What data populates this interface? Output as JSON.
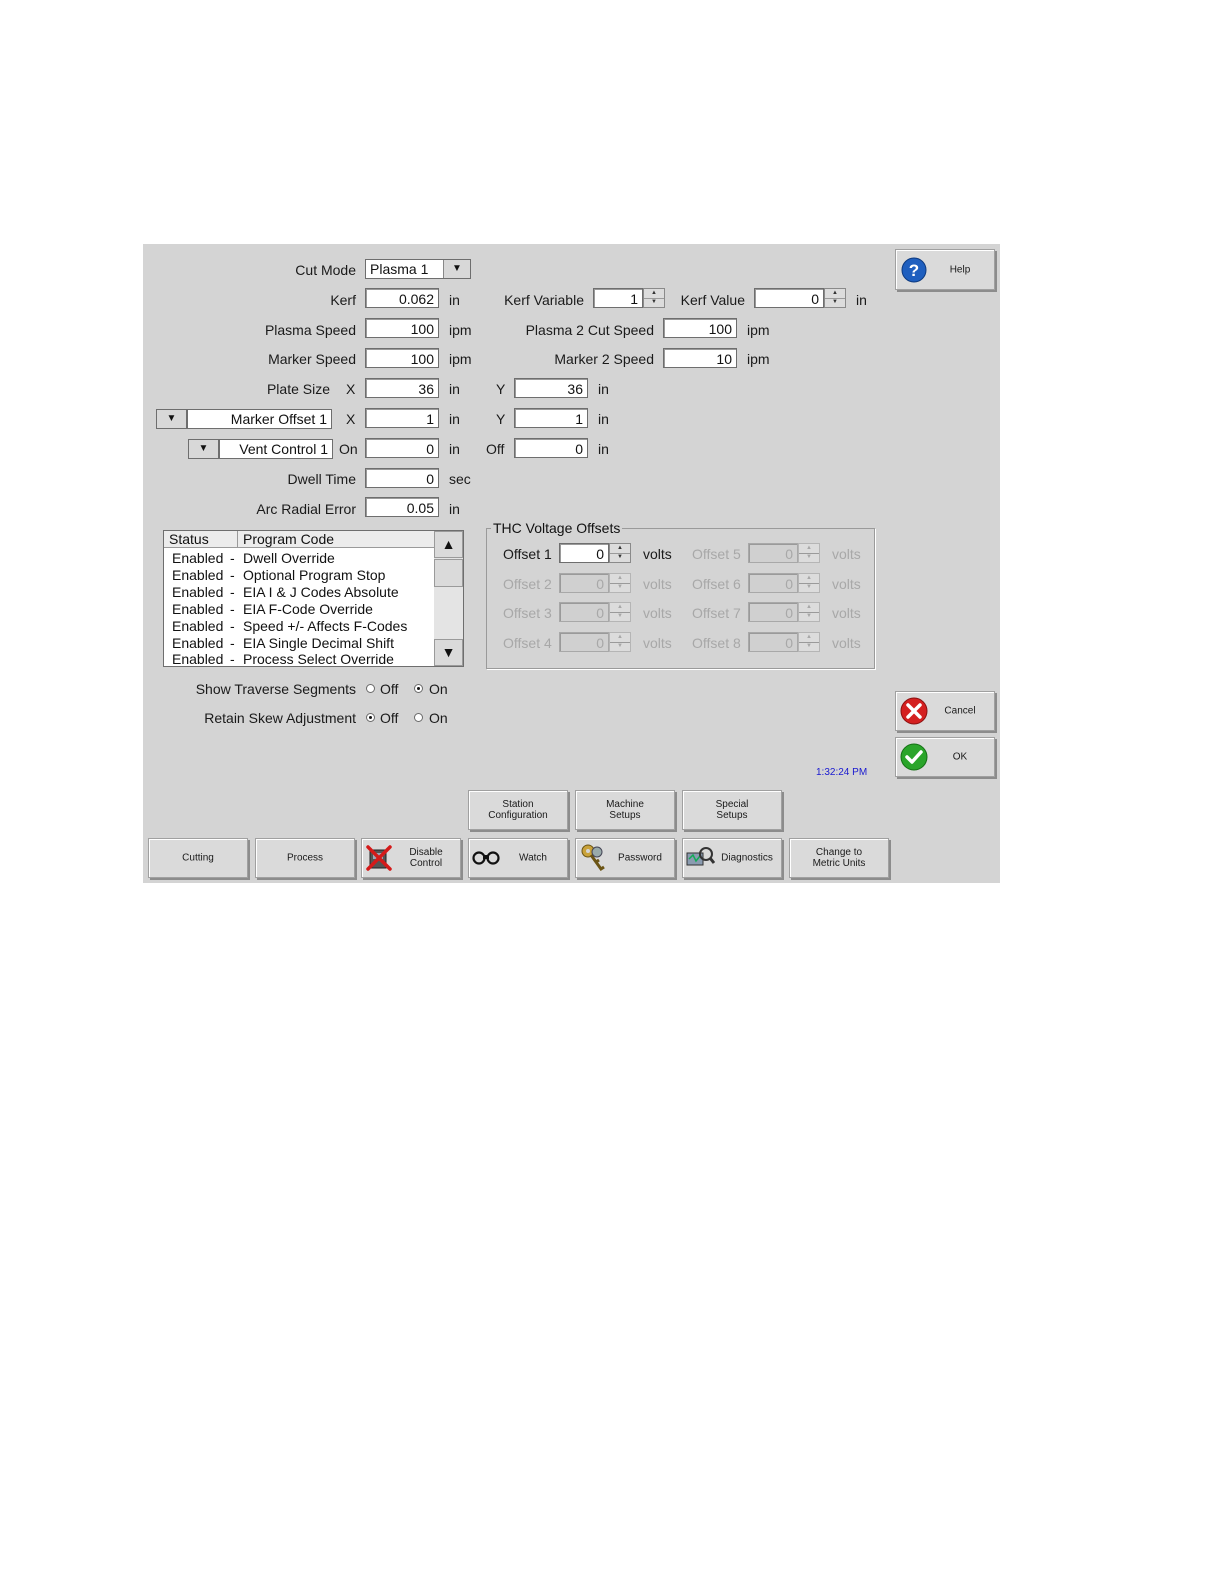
{
  "form": {
    "cut_mode": {
      "label": "Cut Mode",
      "value": "Plasma 1"
    },
    "kerf": {
      "label": "Kerf",
      "value": "0.062",
      "unit": "in"
    },
    "kerf_variable": {
      "label": "Kerf Variable",
      "value": "1"
    },
    "kerf_value": {
      "label": "Kerf Value",
      "value": "0",
      "unit": "in"
    },
    "plasma_speed": {
      "label": "Plasma Speed",
      "value": "100",
      "unit": "ipm"
    },
    "plasma2_cut_speed": {
      "label": "Plasma 2 Cut Speed",
      "value": "100",
      "unit": "ipm"
    },
    "marker_speed": {
      "label": "Marker Speed",
      "value": "100",
      "unit": "ipm"
    },
    "marker2_speed": {
      "label": "Marker 2 Speed",
      "value": "10",
      "unit": "ipm"
    },
    "plate_size": {
      "label": "Plate Size",
      "x_label": "X",
      "x": "36",
      "x_unit": "in",
      "y_label": "Y",
      "y": "36",
      "y_unit": "in"
    },
    "marker_offset": {
      "select": "Marker Offset 1",
      "x_label": "X",
      "x": "1",
      "x_unit": "in",
      "y_label": "Y",
      "y": "1",
      "y_unit": "in"
    },
    "vent_control": {
      "select": "Vent Control 1",
      "on_label": "On",
      "on": "0",
      "on_unit": "in",
      "off_label": "Off",
      "off": "0",
      "off_unit": "in"
    },
    "dwell_time": {
      "label": "Dwell Time",
      "value": "0",
      "unit": "sec"
    },
    "arc_radial_error": {
      "label": "Arc Radial Error",
      "value": "0.05",
      "unit": "in"
    }
  },
  "program_codes": {
    "headers": [
      "Status",
      "Program Code"
    ],
    "rows": [
      {
        "status": "Enabled",
        "sep": "-",
        "code": "Dwell Override"
      },
      {
        "status": "Enabled",
        "sep": "-",
        "code": "Optional Program Stop"
      },
      {
        "status": "Enabled",
        "sep": "-",
        "code": "EIA I & J Codes Absolute"
      },
      {
        "status": "Enabled",
        "sep": "-",
        "code": "EIA F-Code Override"
      },
      {
        "status": "Enabled",
        "sep": "-",
        "code": "Speed +/- Affects F-Codes"
      },
      {
        "status": "Enabled",
        "sep": "-",
        "code": "EIA Single Decimal Shift"
      },
      {
        "status": "Enabled",
        "sep": "-",
        "code": "Process Select Override"
      }
    ]
  },
  "thc": {
    "title": "THC Voltage Offsets",
    "unit": "volts",
    "offsets": [
      {
        "label": "Offset 1",
        "value": "0",
        "enabled": true
      },
      {
        "label": "Offset 2",
        "value": "0",
        "enabled": false
      },
      {
        "label": "Offset 3",
        "value": "0",
        "enabled": false
      },
      {
        "label": "Offset 4",
        "value": "0",
        "enabled": false
      },
      {
        "label": "Offset 5",
        "value": "0",
        "enabled": false
      },
      {
        "label": "Offset 6",
        "value": "0",
        "enabled": false
      },
      {
        "label": "Offset 7",
        "value": "0",
        "enabled": false
      },
      {
        "label": "Offset 8",
        "value": "0",
        "enabled": false
      }
    ]
  },
  "options": {
    "show_traverse": {
      "label": "Show Traverse Segments",
      "off": "Off",
      "on": "On",
      "selected": "On"
    },
    "retain_skew": {
      "label": "Retain Skew Adjustment",
      "off": "Off",
      "on": "On",
      "selected": "Off"
    }
  },
  "side_buttons": {
    "help": "Help",
    "cancel": "Cancel",
    "ok": "OK"
  },
  "clock": "1:32:24 PM",
  "softkeys_top": [
    {
      "label": "Station\nConfiguration"
    },
    {
      "label": "Machine\nSetups"
    },
    {
      "label": "Special\nSetups"
    }
  ],
  "softkeys_bottom": [
    {
      "label": "Cutting"
    },
    {
      "label": "Process"
    },
    {
      "label": "Disable\nControl",
      "icon": "disable-control-icon"
    },
    {
      "label": "Watch",
      "icon": "binoculars-icon"
    },
    {
      "label": "Password",
      "icon": "keys-icon"
    },
    {
      "label": "Diagnostics",
      "icon": "diagnostics-icon"
    },
    {
      "label": "Change to\nMetric Units"
    }
  ],
  "colors": {
    "panel": "#d4d4d4",
    "clock": "#1a1ad0",
    "help_icon": "#1f5fbf",
    "cancel_icon": "#d42020",
    "ok_icon": "#2aa52a"
  }
}
